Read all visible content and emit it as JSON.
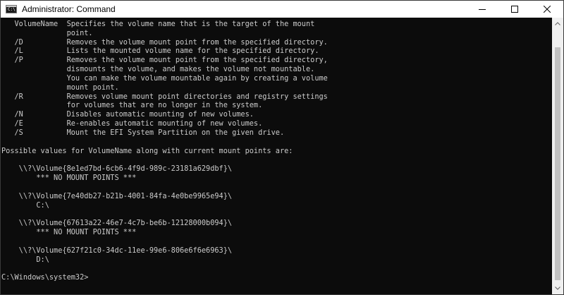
{
  "window": {
    "title": "Administrator: Command",
    "icon": "cmd-app-icon",
    "icon_glyph": "C:\\",
    "controls": [
      "minimize-icon",
      "maximize-icon",
      "close-icon"
    ]
  },
  "console": {
    "lines": [
      "   VolumeName  Specifies the volume name that is the target of the mount",
      "               point.",
      "   /D          Removes the volume mount point from the specified directory.",
      "   /L          Lists the mounted volume name for the specified directory.",
      "   /P          Removes the volume mount point from the specified directory,",
      "               dismounts the volume, and makes the volume not mountable.",
      "               You can make the volume mountable again by creating a volume",
      "               mount point.",
      "   /R          Removes volume mount point directories and registry settings",
      "               for volumes that are no longer in the system.",
      "   /N          Disables automatic mounting of new volumes.",
      "   /E          Re-enables automatic mounting of new volumes.",
      "   /S          Mount the EFI System Partition on the given drive.",
      "",
      "Possible values for VolumeName along with current mount points are:",
      "",
      "    \\\\?\\Volume{8e1ed7bd-6cb6-4f9d-989c-23181a629dbf}\\",
      "        *** NO MOUNT POINTS ***",
      "",
      "    \\\\?\\Volume{7e40db27-b21b-4001-84fa-4e0be9965e94}\\",
      "        C:\\",
      "",
      "    \\\\?\\Volume{67613a22-46e7-4c7b-be6b-12128000b094}\\",
      "        *** NO MOUNT POINTS ***",
      "",
      "    \\\\?\\Volume{627f21c0-34dc-11ee-99e6-806e6f6e6963}\\",
      "        D:\\",
      "",
      "C:\\Windows\\system32>"
    ]
  },
  "colors": {
    "console_bg": "#0c0c0c",
    "console_fg": "#cccccc",
    "titlebar_bg": "#ffffff"
  }
}
